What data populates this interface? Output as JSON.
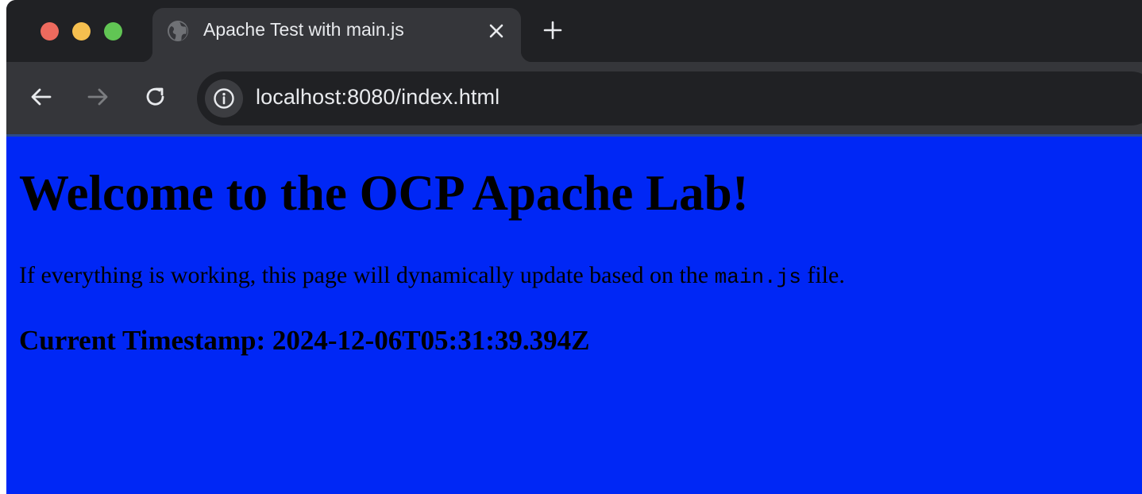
{
  "browser": {
    "tab": {
      "title": "Apache Test with main.js",
      "favicon": "globe-icon"
    },
    "address_bar": {
      "url": "localhost:8080/index.html",
      "site_info_icon": "info-icon"
    },
    "colors": {
      "tabstrip": "#202124",
      "toolbar": "#35363a",
      "close": "#ed6a5e",
      "minimize": "#f5bf4f",
      "maximize": "#61c554"
    }
  },
  "page": {
    "background": "#0027f5",
    "heading": "Welcome to the OCP Apache Lab!",
    "intro_before": "If everything is working, this page will dynamically update based on the ",
    "intro_code": "main.js",
    "intro_after": " file.",
    "timestamp_label": "Current Timestamp: ",
    "timestamp_value": "2024-12-06T05:31:39.394Z"
  }
}
